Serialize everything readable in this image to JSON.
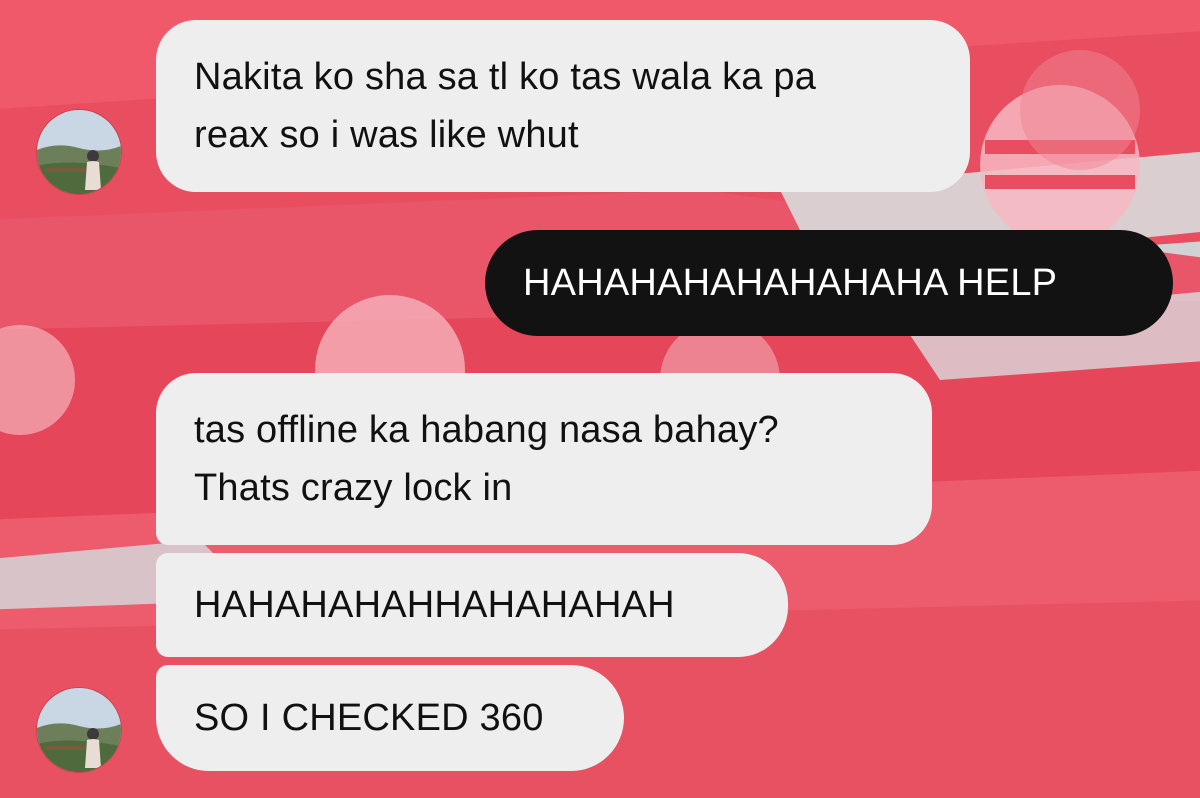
{
  "conversation": {
    "messages": [
      {
        "direction": "incoming",
        "text": "Nakita ko sha sa tl ko tas wala ka pa\nreax so i was like whut"
      },
      {
        "direction": "outgoing",
        "text": "HAHAHAHAHAHAHAHA HELP"
      },
      {
        "direction": "incoming",
        "text": "tas offline ka habang nasa bahay?\nThats crazy lock in"
      },
      {
        "direction": "incoming",
        "text": "HAHAHAHAHHAHAHAHAH"
      },
      {
        "direction": "incoming",
        "text": "SO I CHECKED 360"
      }
    ],
    "avatars": [
      {
        "icon": "contact-avatar-photo"
      },
      {
        "icon": "contact-avatar-photo"
      }
    ]
  },
  "theme": {
    "background_primary": "#e8475b",
    "background_secondary": "#f06a78",
    "background_gray": "#c7c9cb",
    "incoming_bubble": "#eeeeee",
    "outgoing_bubble": "#121212"
  }
}
